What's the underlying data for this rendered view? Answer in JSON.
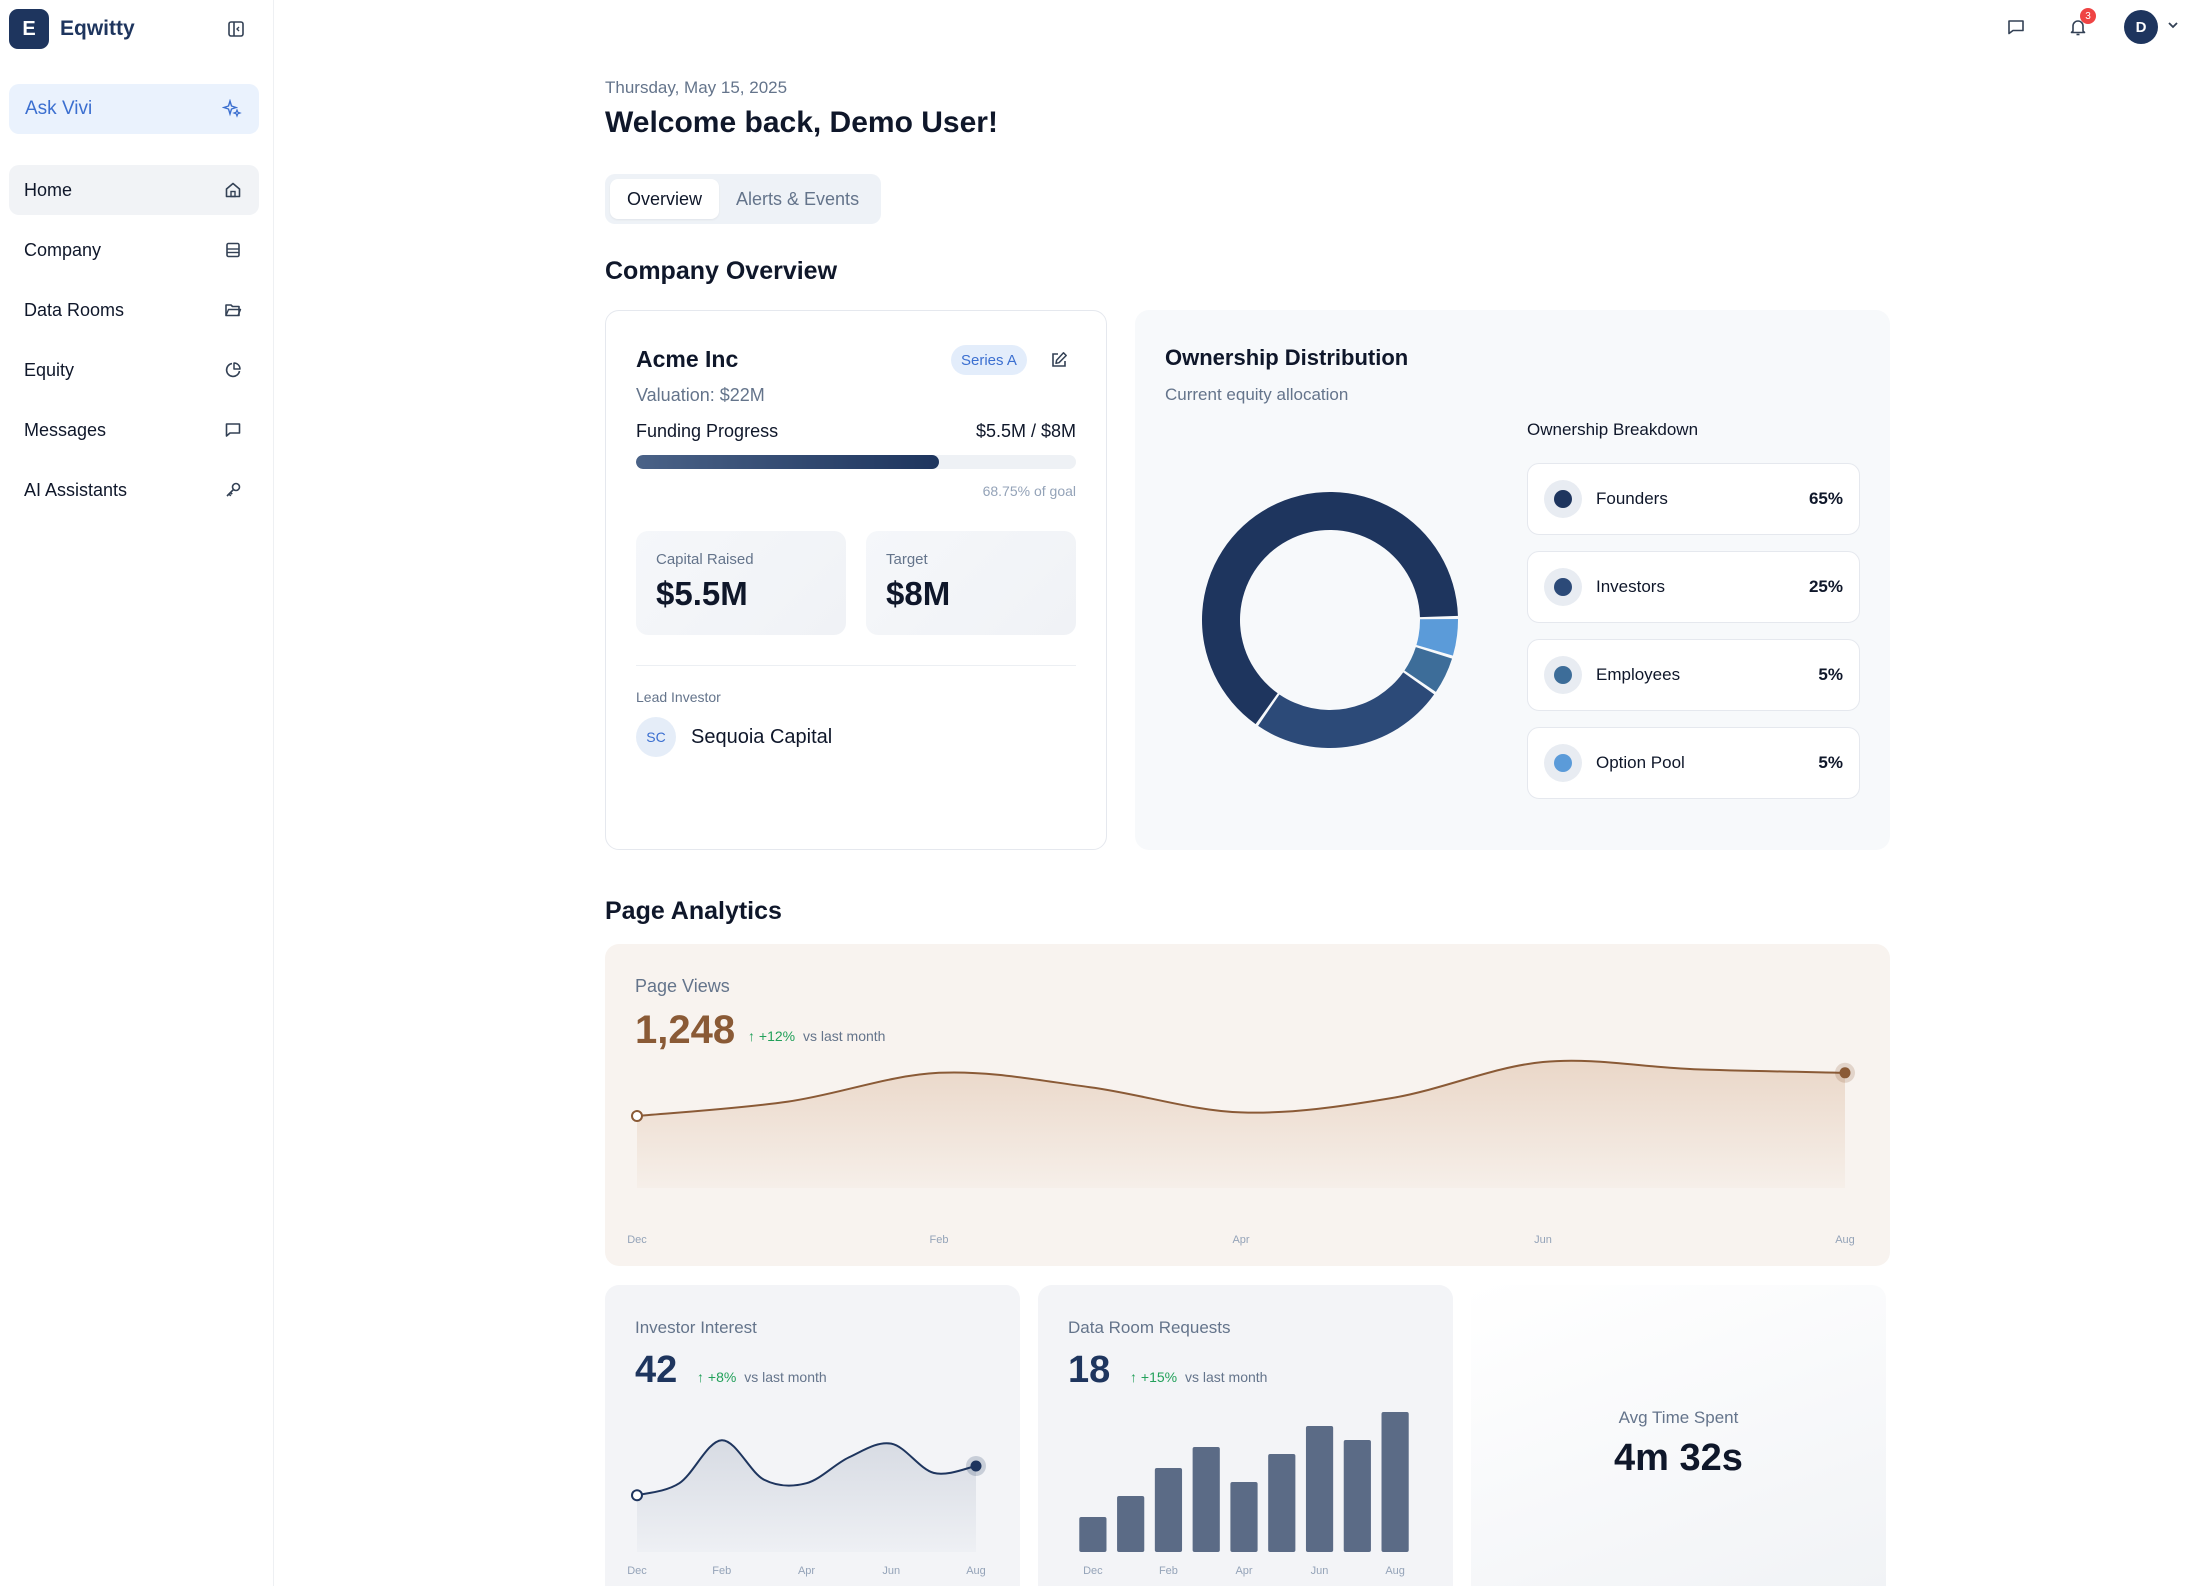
{
  "sidebar": {
    "brand_initial": "E",
    "brand_name": "Eqwitty",
    "collapse_icon": "sidebar-collapse-icon",
    "ask": {
      "label": "Ask Vivi",
      "icon": "sparkle-icon"
    },
    "items": [
      {
        "label": "Home",
        "icon": "home-icon",
        "active": true
      },
      {
        "label": "Company",
        "icon": "building-icon"
      },
      {
        "label": "Data Rooms",
        "icon": "folder-open-icon"
      },
      {
        "label": "Equity",
        "icon": "pie-chart-icon"
      },
      {
        "label": "Messages",
        "icon": "message-square-icon"
      },
      {
        "label": "AI Assistants",
        "icon": "key-icon"
      }
    ]
  },
  "topbar": {
    "notifications_count": "3",
    "avatar_initial": "D"
  },
  "header": {
    "date": "Thursday, May 15, 2025",
    "welcome": "Welcome back, Demo User!",
    "tabs": [
      {
        "label": "Overview"
      },
      {
        "label": "Alerts & Events"
      }
    ]
  },
  "company_overview": {
    "title": "Company Overview",
    "company": {
      "name": "Acme Inc",
      "series": "Series A",
      "valuation": "Valuation: $22M",
      "funding_label": "Funding Progress",
      "funding_value": "$5.5M / $8M",
      "funding_fraction": 0.6875,
      "goal_text": "68.75% of goal",
      "capital_raised_label": "Capital Raised",
      "capital_raised": "$5.5M",
      "target_label": "Target",
      "target": "$8M",
      "lead_label": "Lead Investor",
      "lead_initials": "SC",
      "lead_name": "Sequoia Capital"
    },
    "ownership": {
      "title": "Ownership Distribution",
      "subtitle": "Current equity allocation",
      "breakdown_title": "Ownership Breakdown",
      "items": [
        {
          "name": "Founders",
          "pct": "65%",
          "value": 65,
          "color": "#1e355e"
        },
        {
          "name": "Investors",
          "pct": "25%",
          "value": 25,
          "color": "#2c4a78"
        },
        {
          "name": "Employees",
          "pct": "5%",
          "value": 5,
          "color": "#3d6d99"
        },
        {
          "name": "Option Pool",
          "pct": "5%",
          "value": 5,
          "color": "#5b9bd9"
        }
      ]
    }
  },
  "analytics": {
    "title": "Page Analytics",
    "page_views": {
      "label": "Page Views",
      "value": "1,248",
      "delta": "+12%",
      "vs": "vs last month"
    },
    "investor_interest": {
      "label": "Investor Interest",
      "value": "42",
      "delta": "+8%",
      "vs": "vs last month"
    },
    "data_room": {
      "label": "Data Room Requests",
      "value": "18",
      "delta": "+15%",
      "vs": "vs last month"
    },
    "avg_time": {
      "label": "Avg Time Spent",
      "value": "4m 32s"
    }
  },
  "chart_data": [
    {
      "type": "area",
      "x": [
        "Dec",
        "Jan",
        "Feb",
        "Mar",
        "Apr",
        "May",
        "Jun",
        "Jul",
        "Aug"
      ],
      "x_tick_labels": [
        "Dec",
        "Feb",
        "Apr",
        "Jun",
        "Aug"
      ],
      "values": [
        100,
        120,
        160,
        140,
        105,
        125,
        175,
        165,
        160
      ],
      "ylim": [
        0,
        300
      ],
      "color": "#8a5a36"
    },
    {
      "type": "area",
      "x": [
        "Dec",
        "Jan",
        "Feb",
        "Mar",
        "Apr",
        "May",
        "Jun",
        "Jul",
        "Aug"
      ],
      "x_tick_labels": [
        "Dec",
        "Feb",
        "Apr",
        "Jun",
        "Aug"
      ],
      "values": [
        33,
        40,
        65,
        42,
        40,
        55,
        63,
        46,
        50
      ],
      "ylim": [
        0,
        100
      ],
      "color": "#1e355e"
    },
    {
      "type": "bar",
      "categories": [
        "Dec",
        "Jan",
        "Feb",
        "Mar",
        "Apr",
        "May",
        "Jun",
        "Jul",
        "Aug"
      ],
      "x_tick_labels": [
        "Dec",
        "Feb",
        "Apr",
        "Jun",
        "Aug"
      ],
      "values": [
        5,
        8,
        12,
        15,
        10,
        14,
        18,
        16,
        20
      ],
      "ylim": [
        0,
        20
      ],
      "color": "#5b6b86"
    }
  ]
}
